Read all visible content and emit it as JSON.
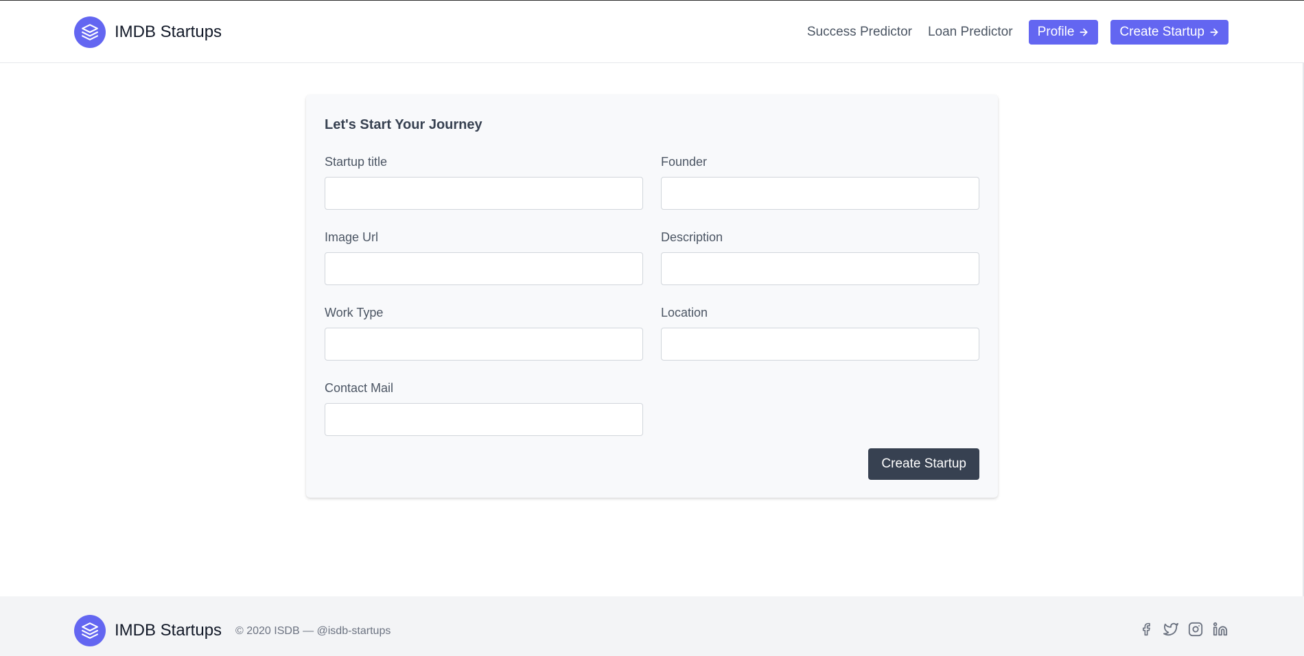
{
  "header": {
    "brand": "IMDB Startups",
    "nav": {
      "success_predictor": "Success Predictor",
      "loan_predictor": "Loan Predictor",
      "profile": "Profile",
      "create_startup": "Create Startup"
    }
  },
  "form": {
    "title": "Let's Start Your Journey",
    "fields": {
      "startup_title": {
        "label": "Startup title",
        "value": ""
      },
      "founder": {
        "label": "Founder",
        "value": ""
      },
      "image_url": {
        "label": "Image Url",
        "value": ""
      },
      "description": {
        "label": "Description",
        "value": ""
      },
      "work_type": {
        "label": "Work Type",
        "value": ""
      },
      "location": {
        "label": "Location",
        "value": ""
      },
      "contact_mail": {
        "label": "Contact Mail",
        "value": ""
      }
    },
    "submit_label": "Create Startup"
  },
  "footer": {
    "brand": "IMDB Startups",
    "copyright": "© 2020 ISDB — @isdb-startups",
    "social": [
      "facebook-icon",
      "twitter-icon",
      "instagram-icon",
      "linkedin-icon"
    ]
  },
  "colors": {
    "accent": "#6366f1",
    "dark_button": "#374151",
    "card_bg": "#f8f9fb",
    "footer_bg": "#f3f4f6"
  }
}
